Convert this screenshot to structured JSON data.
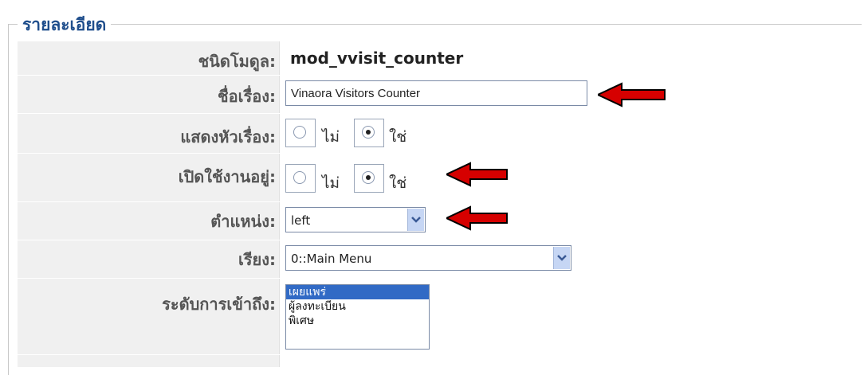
{
  "legend": "รายละเอียด",
  "fields": {
    "module_type": {
      "label": "ชนิดโมดูล:",
      "value": "mod_vvisit_counter"
    },
    "title": {
      "label": "ชื่อเรื่อง:",
      "value": "Vinaora Visitors Counter"
    },
    "show_title": {
      "label": "แสดงหัวเรื่อง:",
      "options": [
        "ไม่",
        "ใช่"
      ],
      "selected": "ใช่"
    },
    "enabled": {
      "label": "เปิดใช้งานอยู่:",
      "options": [
        "ไม่",
        "ใช่"
      ],
      "selected": "ใช่"
    },
    "position": {
      "label": "ตำแหน่ง:",
      "value": "left"
    },
    "order": {
      "label": "เรียง:",
      "value": "0::Main Menu"
    },
    "access": {
      "label": "ระดับการเข้าถึง:",
      "options": [
        "เผยแพร่",
        "ผู้ลงทะเบียน",
        "พิเศษ"
      ],
      "selected": "เผยแพร่"
    }
  },
  "colors": {
    "arrow_fill": "#d60000",
    "legend": "#1f4e8c",
    "label_bg": "#f0f0f0"
  }
}
